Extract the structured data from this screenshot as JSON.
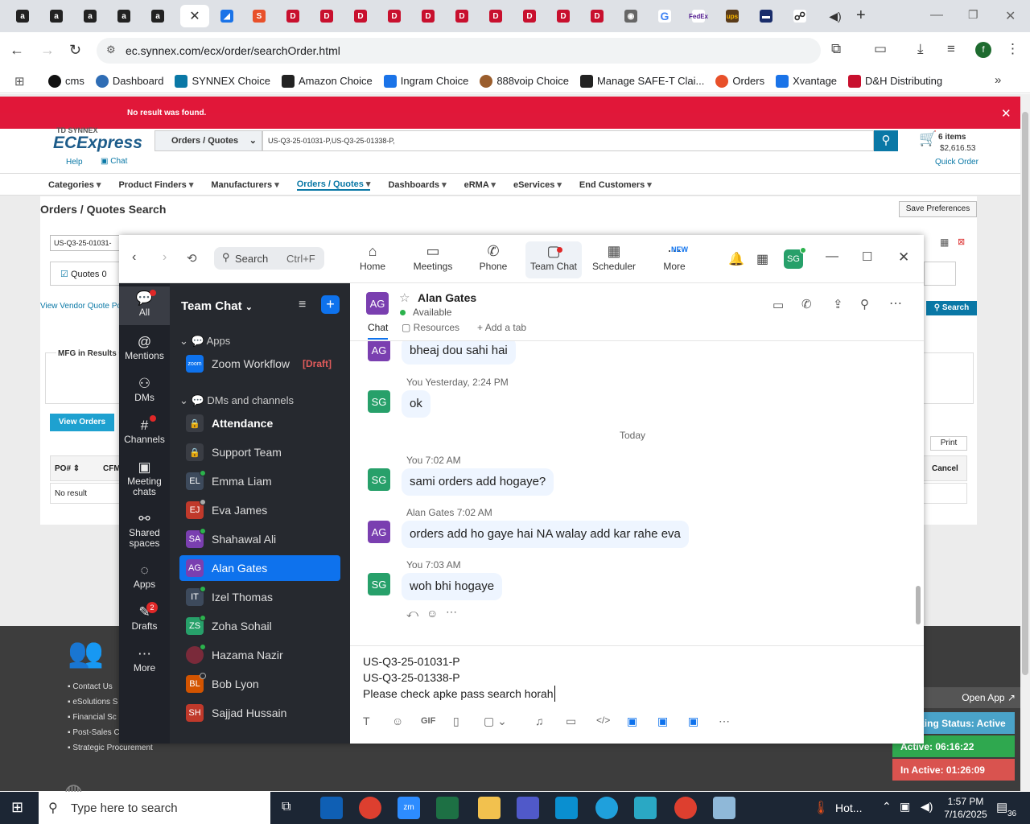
{
  "browser": {
    "url": "ec.synnex.com/ecx/order/searchOrder.html",
    "bookmarks": [
      "cms",
      "Dashboard",
      "SYNNEX Choice",
      "Amazon Choice",
      "Ingram Choice",
      "888voip Choice",
      "Manage SAFE-T Clai...",
      "Orders",
      "Xvantage",
      "D&H Distributing"
    ]
  },
  "ec": {
    "alert": "No result was found.",
    "brand_small": "TD SYNNEX",
    "brand": "ECExpress",
    "help": "Help",
    "chat": "Chat",
    "search_scope": "Orders / Quotes",
    "search_value": "US-Q3-25-01031-P,US-Q3-25-01338-P,",
    "cart_items": "6 items",
    "cart_total": "$2,616.53",
    "quick_order": "Quick Order",
    "nav": [
      "Categories",
      "Product Finders",
      "Manufacturers",
      "Orders / Quotes",
      "Dashboards",
      "eRMA",
      "eServices",
      "End Customers"
    ],
    "page_title": "Orders / Quotes Search",
    "save_prefs": "Save Preferences",
    "filter_value": "US-Q3-25-01031-",
    "quotes_label": "Quotes 0",
    "vendor_link": "View Vendor Quote Po",
    "mfg_results": "MFG in Results",
    "view_orders": "View Orders",
    "col_po": "PO#",
    "col_cfm": "CFM",
    "no_result": "No result",
    "search_btn": "Search",
    "print_btn": "Print",
    "cancel_btn": "Cancel",
    "footer_links": [
      "Contact Us",
      "eSolutions S",
      "Financial Sc",
      "Post-Sales C",
      "Strategic Procurement"
    ],
    "open_app": "Open App",
    "working_status": "Working Status: Active",
    "active_time": "Active: 06:16:22",
    "inactive_time": "In Active: 01:26:09"
  },
  "zoom": {
    "search_placeholder": "Search",
    "search_shortcut": "Ctrl+F",
    "nav": [
      "Home",
      "Meetings",
      "Phone",
      "Team Chat",
      "Scheduler",
      "More"
    ],
    "new_badge": "NEW",
    "user_initials": "SG",
    "rail": [
      "All",
      "Mentions",
      "DMs",
      "Channels",
      "Meeting chats",
      "Shared spaces",
      "Apps",
      "Drafts",
      "More"
    ],
    "drafts_badge": "2",
    "list_title": "Team Chat",
    "section_apps": "Apps",
    "section_dms": "DMs and channels",
    "zoom_workflow": "Zoom Workflow",
    "draft_tag": "[Draft]",
    "contacts": [
      {
        "initials": "",
        "name": "Attendance",
        "color": "#3a3d44"
      },
      {
        "initials": "",
        "name": "Support Team",
        "color": "#3a3d44"
      },
      {
        "initials": "EL",
        "name": "Emma Liam",
        "color": "#3d4a5c"
      },
      {
        "initials": "EJ",
        "name": "Eva James",
        "color": "#c0392b"
      },
      {
        "initials": "SA",
        "name": "Shahawal Ali",
        "color": "#7a3fb0"
      },
      {
        "initials": "AG",
        "name": "Alan Gates",
        "color": "#7a3fb0"
      },
      {
        "initials": "IT",
        "name": "Izel Thomas",
        "color": "#3d4a5c"
      },
      {
        "initials": "ZS",
        "name": "Zoha Sohail",
        "color": "#27a06a"
      },
      {
        "initials": "",
        "name": "Hazama Nazir",
        "color": "#7a2a3a"
      },
      {
        "initials": "BL",
        "name": "Bob Lyon",
        "color": "#d35400"
      },
      {
        "initials": "SH",
        "name": "Sajjad Hussain",
        "color": "#c0392b"
      }
    ],
    "chat_user": "Alan Gates",
    "chat_user_initials": "AG",
    "chat_status": "Available",
    "tab_chat": "Chat",
    "tab_resources": "Resources",
    "tab_add": "Add a tab",
    "messages": [
      {
        "initials": "AG",
        "meta": "",
        "text": "bheaj dou sahi hai"
      },
      {
        "initials": "SG",
        "meta": "You Yesterday, 2:24 PM",
        "text": "ok"
      },
      {
        "initials": "SG",
        "meta": "You 7:02 AM",
        "text": "sami orders add hogaye?"
      },
      {
        "initials": "AG",
        "meta": "Alan Gates 7:02 AM",
        "text": "orders add ho gaye hai NA walay add kar rahe eva"
      },
      {
        "initials": "SG",
        "meta": "You 7:03 AM",
        "text": "woh bhi hogaye"
      }
    ],
    "divider": "Today",
    "compose": [
      "US-Q3-25-01031-P",
      "US-Q3-25-01338-P",
      "Please check apke pass search horah"
    ]
  },
  "taskbar": {
    "search_placeholder": "Type here to search",
    "time": "1:57 PM",
    "date": "7/16/2025",
    "weather": "Hot...",
    "notif": "36"
  }
}
